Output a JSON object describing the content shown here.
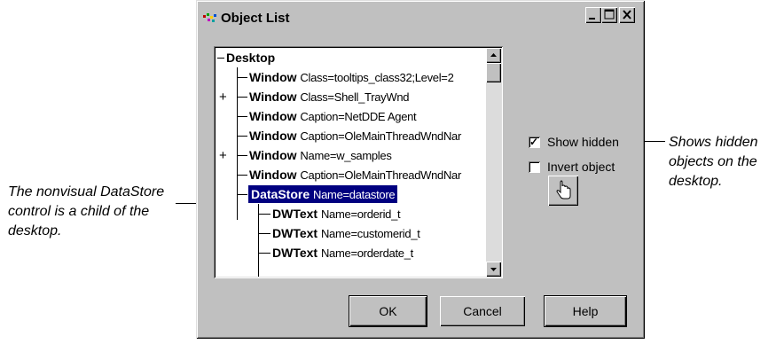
{
  "window": {
    "title": "Object List",
    "minimize_icon": "minimize-icon",
    "maximize_icon": "maximize-icon",
    "close_icon": "close-icon"
  },
  "tree": {
    "root": "Desktop",
    "nodes": [
      {
        "kind": "Window",
        "attr": "Class=tooltips_class32;Level=2",
        "expander": ""
      },
      {
        "kind": "Window",
        "attr": "Class=Shell_TrayWnd",
        "expander": "+"
      },
      {
        "kind": "Window",
        "attr": "Caption=NetDDE Agent",
        "expander": ""
      },
      {
        "kind": "Window",
        "attr": "Caption=OleMainThreadWndNar",
        "expander": ""
      },
      {
        "kind": "Window",
        "attr": "Name=w_samples",
        "expander": "+"
      },
      {
        "kind": "Window",
        "attr": "Caption=OleMainThreadWndNar",
        "expander": ""
      },
      {
        "kind": "DataStore",
        "attr": "Name=datastore",
        "expander": "-",
        "selected": true
      },
      {
        "kind": "DWText",
        "attr": "Name=orderid_t",
        "expander": ""
      },
      {
        "kind": "DWText",
        "attr": "Name=customerid_t",
        "expander": ""
      },
      {
        "kind": "DWText",
        "attr": "Name=orderdate_t",
        "expander": ""
      }
    ]
  },
  "options": {
    "show_hidden": {
      "label": "Show hidden",
      "checked": true
    },
    "invert_object": {
      "label": "Invert object",
      "checked": false
    },
    "pointer_button_icon": "hand-pointer-icon"
  },
  "buttons": {
    "ok": "OK",
    "cancel": "Cancel",
    "help": "Help"
  },
  "annotations": {
    "left": "The nonvisual DataStore control is a child of the desktop.",
    "right": "Shows hidden objects on the desktop."
  }
}
